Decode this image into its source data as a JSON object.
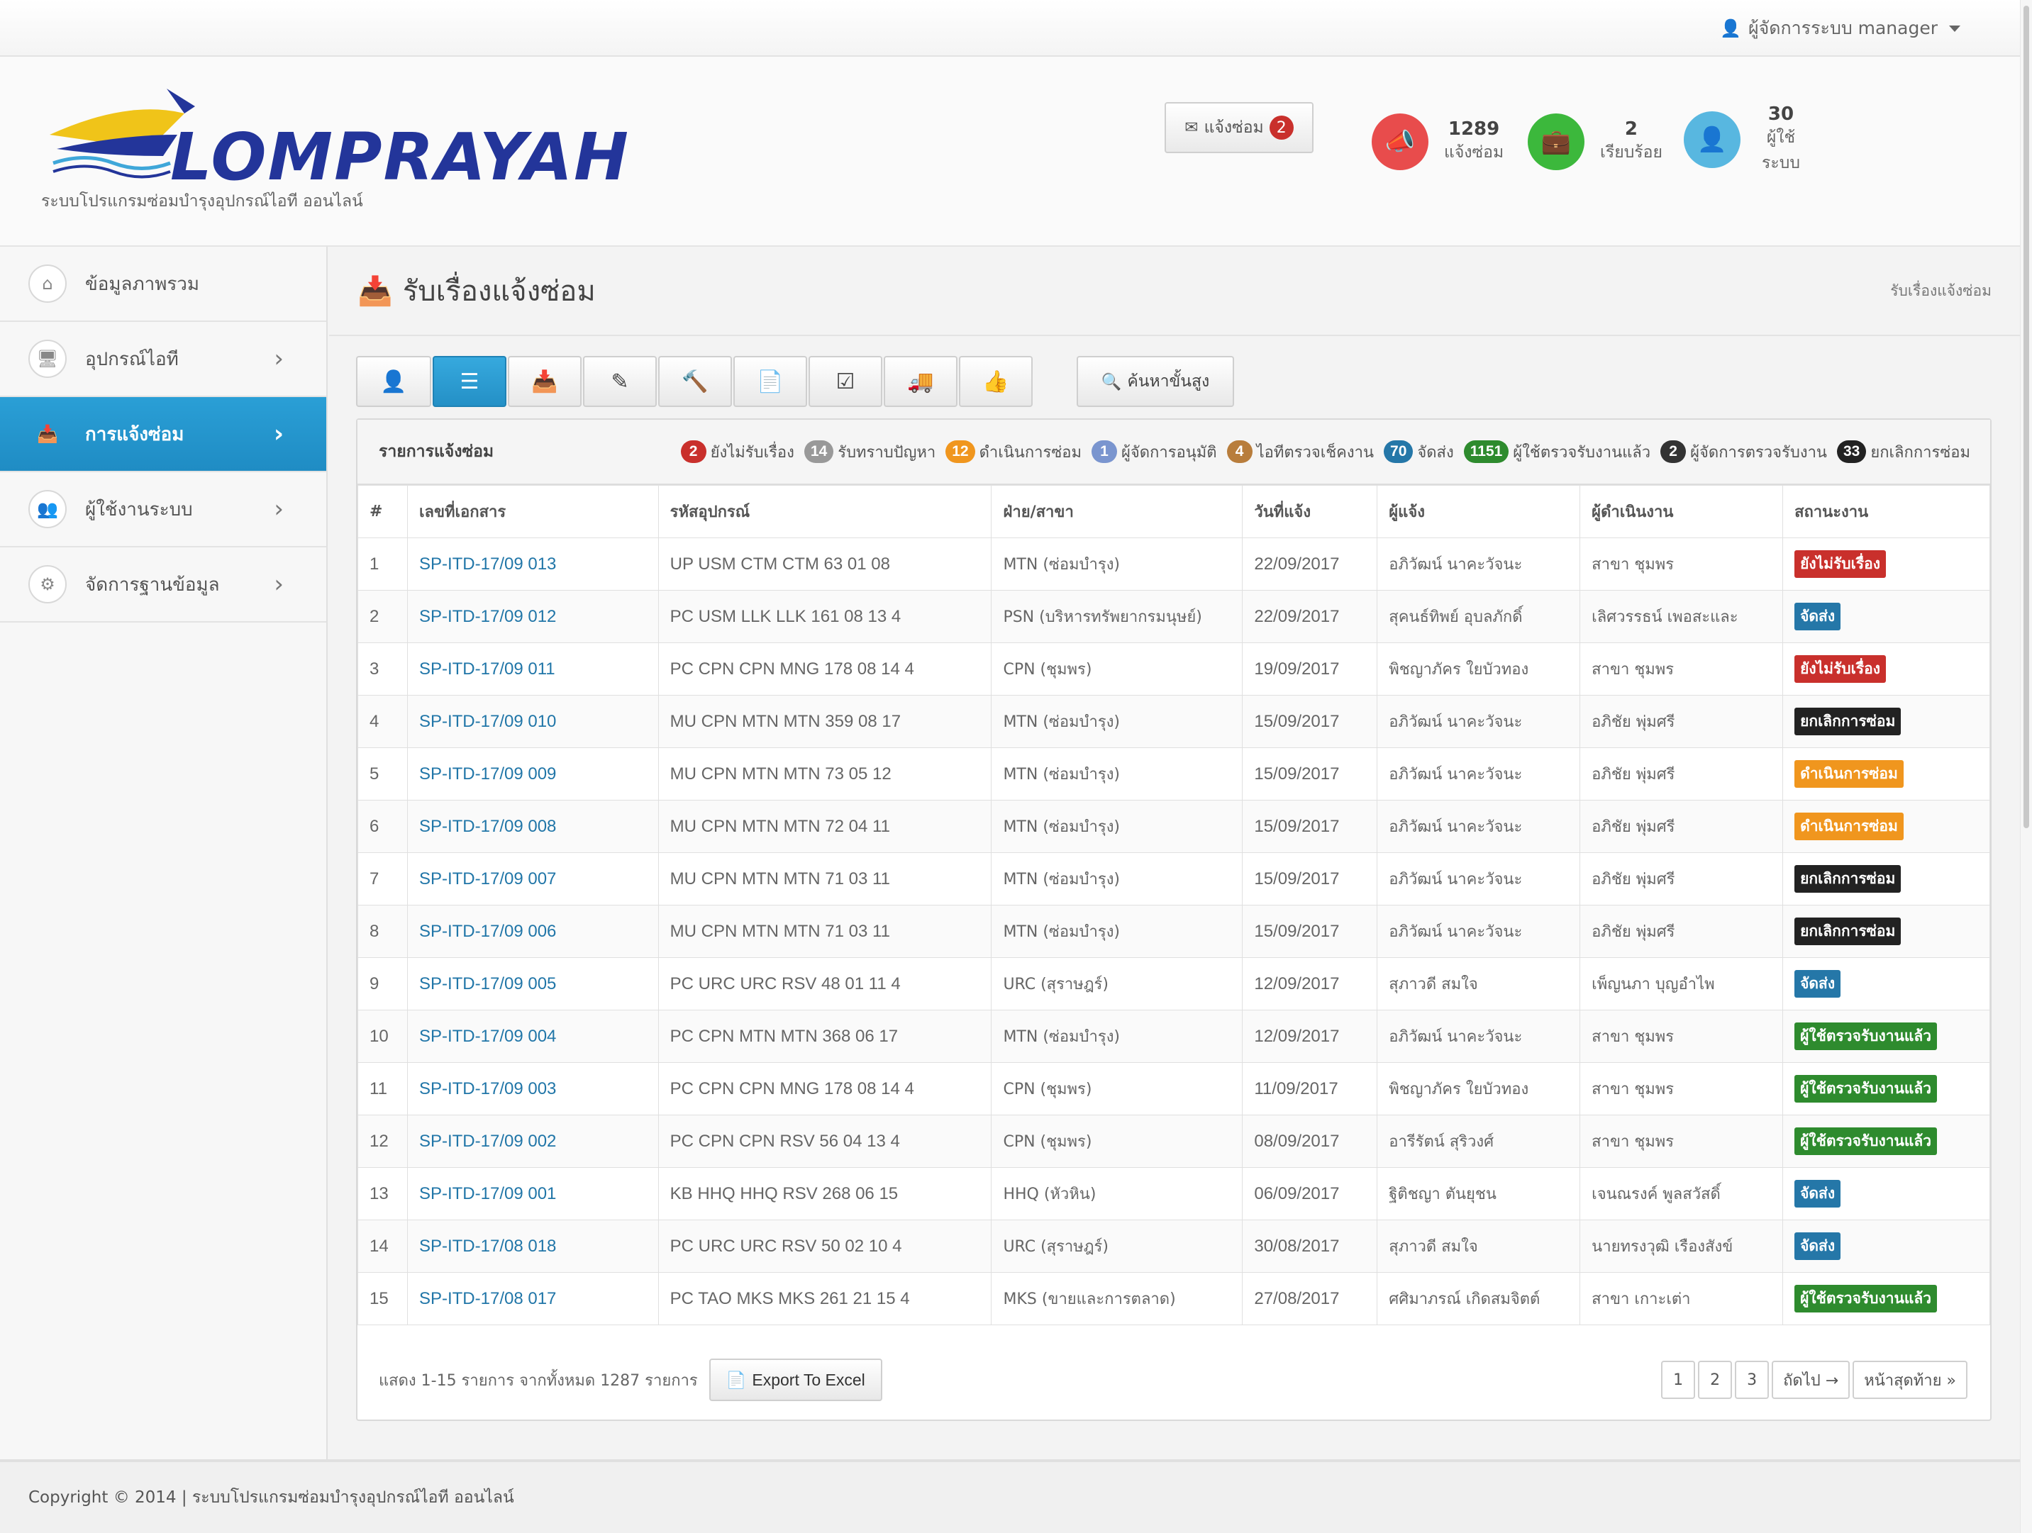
{
  "topbar": {
    "user_label": "ผู้จัดการระบบ manager"
  },
  "header": {
    "logo_text": "LOMPRAYAH",
    "subtitle": "ระบบโปรแกรมซ่อมบำรุงอุปกรณ์ไอที ออนไลน์",
    "notify_button": {
      "label": "แจ้งซ่อม",
      "count": "2"
    },
    "stats": [
      {
        "number": "1289",
        "label": "แจ้งซ่อม",
        "color": "#e84c4c",
        "icon": "megaphone-icon"
      },
      {
        "number": "2",
        "label": "เรียบร้อย",
        "color": "#3cb83c",
        "icon": "briefcase-icon"
      },
      {
        "number": "30",
        "label": "ผู้ใช้ ระบบ",
        "color": "#58b7e0",
        "icon": "user-icon"
      }
    ]
  },
  "sidebar": {
    "items": [
      {
        "label": "ข้อมูลภาพรวม",
        "icon": "home-icon"
      },
      {
        "label": "อุปกรณ์ไอที",
        "icon": "monitor-icon"
      },
      {
        "label": "การแจ้งซ่อม",
        "icon": "inbox-icon",
        "active": true
      },
      {
        "label": "ผู้ใช้งานระบบ",
        "icon": "users-icon"
      },
      {
        "label": "จัดการฐานข้อมูล",
        "icon": "gears-icon"
      }
    ]
  },
  "page": {
    "title": "รับเรื่องแจ้งซ่อม",
    "breadcrumb": "รับเรื่องแจ้งซ่อม"
  },
  "toolbar": {
    "buttons": [
      "user-icon",
      "list-icon",
      "inbox-icon",
      "edit-icon",
      "gavel-icon",
      "file-icon",
      "check-icon",
      "truck-icon",
      "thumbs-up-icon"
    ],
    "search_label": "ค้นหาขั้นสูง"
  },
  "panel": {
    "title": "รายการแจ้งซ่อม",
    "legend": [
      {
        "count": "2",
        "label": "ยังไม่รับเรื่อง",
        "color": "#c9302c"
      },
      {
        "count": "14",
        "label": "รับทราบปัญหา",
        "color": "#999999"
      },
      {
        "count": "12",
        "label": "ดำเนินการซ่อม",
        "color": "#f0961e"
      },
      {
        "count": "1",
        "label": "ผู้จัดการอนุมัติ",
        "color": "#7a95cf"
      },
      {
        "count": "4",
        "label": "ไอทีตรวจเช็คงาน",
        "color": "#b87d3c"
      },
      {
        "count": "70",
        "label": "จัดส่ง",
        "color": "#2577a8"
      },
      {
        "count": "1151",
        "label": "ผู้ใช้ตรวจรับงานแล้ว",
        "color": "#2e8b2e"
      },
      {
        "count": "2",
        "label": "ผู้จัดการตรวจรับงาน",
        "color": "#333333"
      },
      {
        "count": "33",
        "label": "ยกเลิกการซ่อม",
        "color": "#222222"
      }
    ],
    "columns": [
      "#",
      "เลขที่เอกสาร",
      "รหัสอุปกรณ์",
      "ฝ่าย/สาขา",
      "วันที่แจ้ง",
      "ผู้แจ้ง",
      "ผู้ดำเนินงาน",
      "สถานะงาน"
    ],
    "rows": [
      {
        "no": "1",
        "doc": "SP-ITD-17/09 013",
        "device": "UP USM CTM CTM 63 01 08",
        "dept": "MTN (ซ่อมบำรุง)",
        "date": "22/09/2017",
        "reporter": "อภิวัฒน์ นาคะวัจนะ",
        "operator": "สาขา ชุมพร",
        "status": "ยังไม่รับเรื่อง",
        "status_color": "#c9302c"
      },
      {
        "no": "2",
        "doc": "SP-ITD-17/09 012",
        "device": "PC USM LLK LLK 161 08 13 4",
        "dept": "PSN (บริหารทรัพยากรมนุษย์)",
        "date": "22/09/2017",
        "reporter": "สุคนธ์ทิพย์ อุบลภักดิ์",
        "operator": "เลิศวรรธน์ เพอสะและ",
        "status": "จัดส่ง",
        "status_color": "#2577a8"
      },
      {
        "no": "3",
        "doc": "SP-ITD-17/09 011",
        "device": "PC CPN CPN MNG 178 08 14 4",
        "dept": "CPN (ชุมพร)",
        "date": "19/09/2017",
        "reporter": "พิชญาภัคร ใยบัวทอง",
        "operator": "สาขา ชุมพร",
        "status": "ยังไม่รับเรื่อง",
        "status_color": "#c9302c"
      },
      {
        "no": "4",
        "doc": "SP-ITD-17/09 010",
        "device": "MU CPN MTN MTN 359 08 17",
        "dept": "MTN (ซ่อมบำรุง)",
        "date": "15/09/2017",
        "reporter": "อภิวัฒน์ นาคะวัจนะ",
        "operator": "อภิชัย พุ่มศรี",
        "status": "ยกเลิกการซ่อม",
        "status_color": "#222222"
      },
      {
        "no": "5",
        "doc": "SP-ITD-17/09 009",
        "device": "MU CPN MTN MTN 73 05 12",
        "dept": "MTN (ซ่อมบำรุง)",
        "date": "15/09/2017",
        "reporter": "อภิวัฒน์ นาคะวัจนะ",
        "operator": "อภิชัย พุ่มศรี",
        "status": "ดำเนินการซ่อม",
        "status_color": "#f0961e"
      },
      {
        "no": "6",
        "doc": "SP-ITD-17/09 008",
        "device": "MU CPN MTN MTN 72 04 11",
        "dept": "MTN (ซ่อมบำรุง)",
        "date": "15/09/2017",
        "reporter": "อภิวัฒน์ นาคะวัจนะ",
        "operator": "อภิชัย พุ่มศรี",
        "status": "ดำเนินการซ่อม",
        "status_color": "#f0961e"
      },
      {
        "no": "7",
        "doc": "SP-ITD-17/09 007",
        "device": "MU CPN MTN MTN 71 03 11",
        "dept": "MTN (ซ่อมบำรุง)",
        "date": "15/09/2017",
        "reporter": "อภิวัฒน์ นาคะวัจนะ",
        "operator": "อภิชัย พุ่มศรี",
        "status": "ยกเลิกการซ่อม",
        "status_color": "#222222"
      },
      {
        "no": "8",
        "doc": "SP-ITD-17/09 006",
        "device": "MU CPN MTN MTN 71 03 11",
        "dept": "MTN (ซ่อมบำรุง)",
        "date": "15/09/2017",
        "reporter": "อภิวัฒน์ นาคะวัจนะ",
        "operator": "อภิชัย พุ่มศรี",
        "status": "ยกเลิกการซ่อม",
        "status_color": "#222222"
      },
      {
        "no": "9",
        "doc": "SP-ITD-17/09 005",
        "device": "PC URC URC RSV 48 01 11 4",
        "dept": "URC (สุราษฎร์)",
        "date": "12/09/2017",
        "reporter": "สุภาวดี สมใจ",
        "operator": "เพ็ญนภา บุญอำไพ",
        "status": "จัดส่ง",
        "status_color": "#2577a8"
      },
      {
        "no": "10",
        "doc": "SP-ITD-17/09 004",
        "device": "PC CPN MTN MTN 368 06 17",
        "dept": "MTN (ซ่อมบำรุง)",
        "date": "12/09/2017",
        "reporter": "อภิวัฒน์ นาคะวัจนะ",
        "operator": "สาขา ชุมพร",
        "status": "ผู้ใช้ตรวจรับงานแล้ว",
        "status_color": "#2e8b2e"
      },
      {
        "no": "11",
        "doc": "SP-ITD-17/09 003",
        "device": "PC CPN CPN MNG 178 08 14 4",
        "dept": "CPN (ชุมพร)",
        "date": "11/09/2017",
        "reporter": "พิชญาภัคร ใยบัวทอง",
        "operator": "สาขา ชุมพร",
        "status": "ผู้ใช้ตรวจรับงานแล้ว",
        "status_color": "#2e8b2e"
      },
      {
        "no": "12",
        "doc": "SP-ITD-17/09 002",
        "device": "PC CPN CPN RSV 56 04 13 4",
        "dept": "CPN (ชุมพร)",
        "date": "08/09/2017",
        "reporter": "อารีรัตน์ สุริวงศ์",
        "operator": "สาขา ชุมพร",
        "status": "ผู้ใช้ตรวจรับงานแล้ว",
        "status_color": "#2e8b2e"
      },
      {
        "no": "13",
        "doc": "SP-ITD-17/09 001",
        "device": "KB HHQ HHQ RSV 268 06 15",
        "dept": "HHQ (หัวหิน)",
        "date": "06/09/2017",
        "reporter": "ฐิติชญา ตันยุชน",
        "operator": "เจนณรงค์ พูลสวัสดิ์",
        "status": "จัดส่ง",
        "status_color": "#2577a8"
      },
      {
        "no": "14",
        "doc": "SP-ITD-17/08 018",
        "device": "PC URC URC RSV 50 02 10 4",
        "dept": "URC (สุราษฎร์)",
        "date": "30/08/2017",
        "reporter": "สุภาวดี สมใจ",
        "operator": "นายทรงวุฒิ เรืองสังข์",
        "status": "จัดส่ง",
        "status_color": "#2577a8"
      },
      {
        "no": "15",
        "doc": "SP-ITD-17/08 017",
        "device": "PC TAO MKS MKS 261 21 15 4",
        "dept": "MKS (ขายและการตลาด)",
        "date": "27/08/2017",
        "reporter": "ศศิมาภรณ์ เกิดสมจิตต์",
        "operator": "สาขา เกาะเต่า",
        "status": "ผู้ใช้ตรวจรับงานแล้ว",
        "status_color": "#2e8b2e"
      }
    ],
    "footer_info": "แสดง 1-15 รายการ จากทั้งหมด 1287 รายการ",
    "excel_label": "Export To Excel",
    "pagination": [
      "1",
      "2",
      "3",
      "ถัดไป →",
      "หน้าสุดท้าย »"
    ]
  },
  "footer": {
    "text": "Copyright © 2014 | ระบบโปรแกรมซ่อมบำรุงอุปกรณ์ไอที ออนไลน์"
  }
}
